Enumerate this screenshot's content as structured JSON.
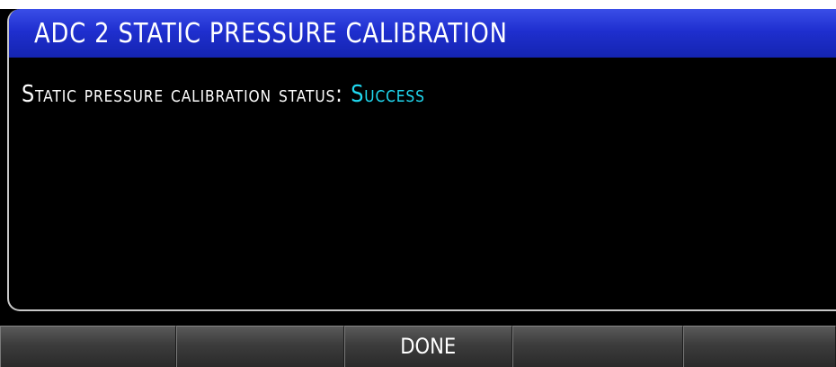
{
  "page": {
    "title": "ADC 2 STATIC PRESSURE CALIBRATION"
  },
  "status": {
    "label": "Static pressure calibration status:",
    "value": "Success",
    "value_color": "#20d8f0"
  },
  "softkeys": [
    {
      "label": ""
    },
    {
      "label": ""
    },
    {
      "label": "DONE"
    },
    {
      "label": ""
    },
    {
      "label": ""
    }
  ],
  "colors": {
    "title_bar": "#1f2fcf",
    "background": "#000000",
    "text": "#ffffff"
  }
}
